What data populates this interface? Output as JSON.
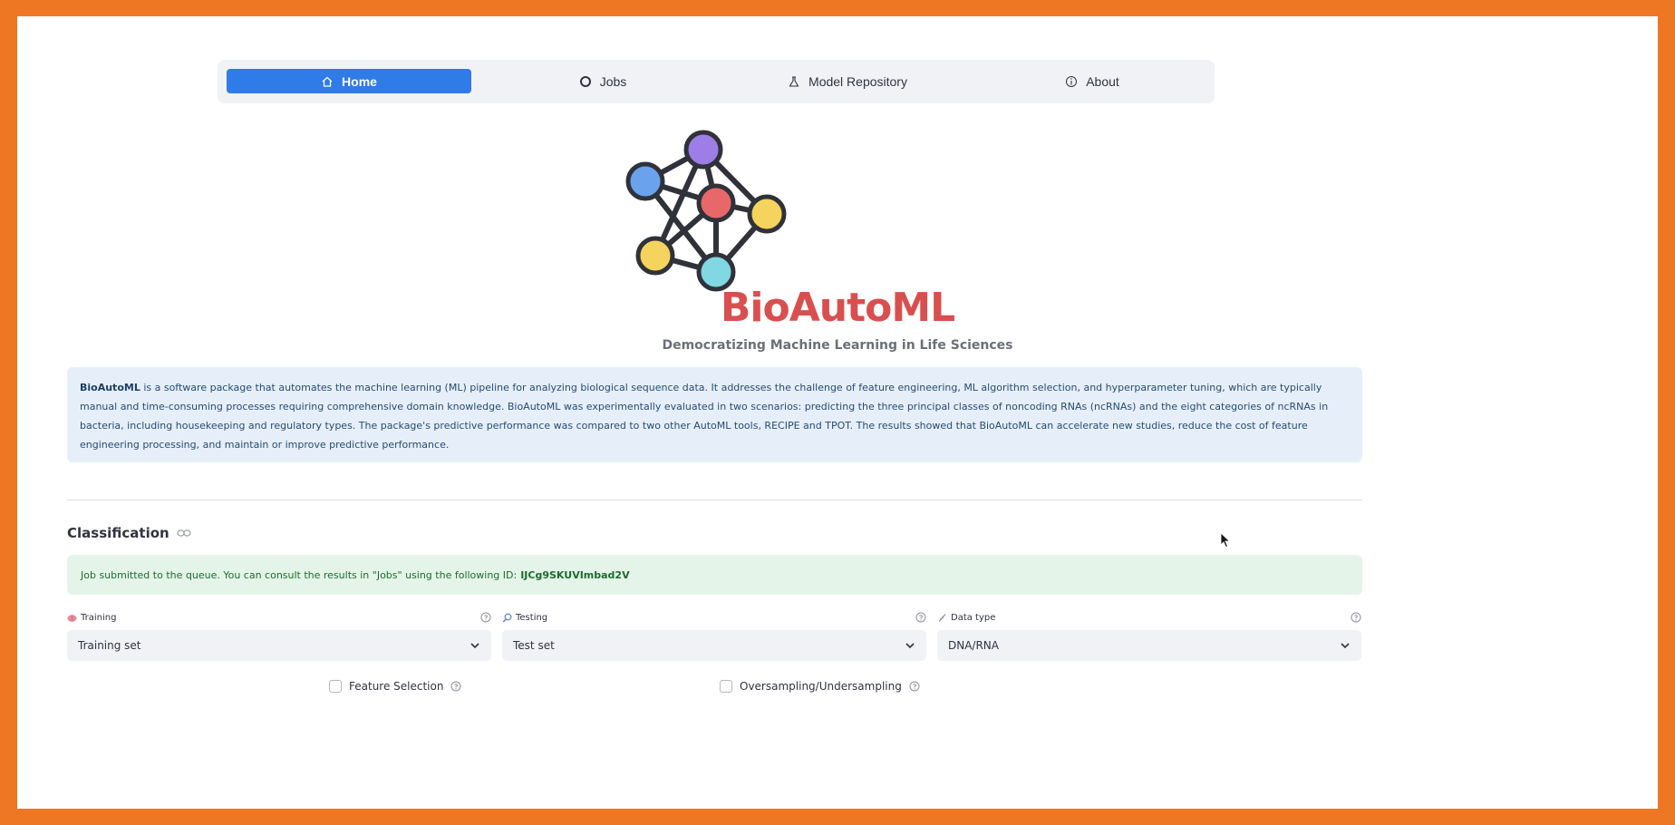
{
  "nav": {
    "items": [
      {
        "label": "Home",
        "icon": "home-icon",
        "active": true
      },
      {
        "label": "Jobs",
        "icon": "circle-icon",
        "active": false
      },
      {
        "label": "Model Repository",
        "icon": "flask-icon",
        "active": false
      },
      {
        "label": "About",
        "icon": "info-icon",
        "active": false
      }
    ]
  },
  "header": {
    "title": "BioAutoML",
    "tagline": "Democratizing Machine Learning in Life Sciences"
  },
  "info": {
    "lead": "BioAutoML",
    "text": " is a software package that automates the machine learning (ML) pipeline for analyzing biological sequence data. It addresses the challenge of feature engineering, ML algorithm selection, and hyperparameter tuning, which are typically manual and time-consuming processes requiring comprehensive domain knowledge. BioAutoML was experimentally evaluated in two scenarios: predicting the three principal classes of noncoding RNAs (ncRNAs) and the eight categories of ncRNAs in bacteria, including housekeeping and regulatory types. The package's predictive performance was compared to two other AutoML tools, RECIPE and TPOT. The results showed that BioAutoML can accelerate new studies, reduce the cost of feature engineering processing, and maintain or improve predictive performance."
  },
  "classification": {
    "heading": "Classification",
    "success_message": "Job submitted to the queue. You can consult the results in \"Jobs\" using the following ID:",
    "job_id": "IJCg9SKUVImbad2V",
    "fields": {
      "training": {
        "label": "Training",
        "value": "Training set",
        "icon": "brain-icon"
      },
      "testing": {
        "label": "Testing",
        "value": "Test set",
        "icon": "magnifier-icon"
      },
      "data_type": {
        "label": "Data type",
        "value": "DNA/RNA",
        "icon": "dna-icon"
      }
    },
    "options": {
      "feature_selection": {
        "label": "Feature Selection",
        "checked": false
      },
      "sampling": {
        "label": "Oversampling/Undersampling",
        "checked": false
      }
    }
  },
  "colors": {
    "accent": "#2f7be8",
    "brand": "#d94f4f",
    "frame": "#ee7724"
  }
}
